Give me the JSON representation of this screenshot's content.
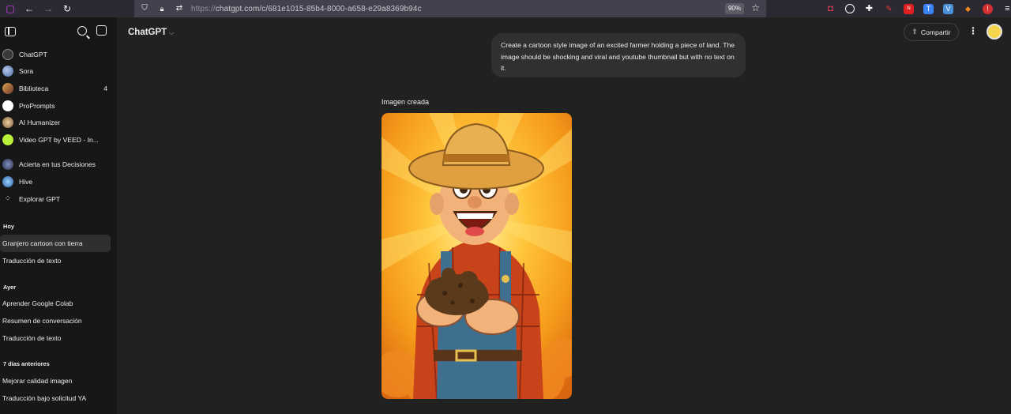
{
  "browser": {
    "url_scheme": "https://",
    "url_rest": "chatgpt.com/c/681e1015-85b4-8000-a658-e29a8369b94c",
    "zoom": "90%"
  },
  "sidebar": {
    "gpts": [
      {
        "label": "ChatGPT",
        "icon": "chatgpt-icon",
        "color": "#3a3a3a"
      },
      {
        "label": "Sora",
        "icon": "sora-icon",
        "color": "#6b8fc9"
      },
      {
        "label": "Biblioteca",
        "icon": "library-icon",
        "color": "#c8603a",
        "count": "4"
      },
      {
        "label": "ProPrompts",
        "icon": "proprompts-icon",
        "color": "#ffffff"
      },
      {
        "label": "AI Humanizer",
        "icon": "humanizer-icon",
        "color": "#c9a26b"
      },
      {
        "label": "Video GPT by VEED - In...",
        "icon": "veed-icon",
        "color": "#b8f03a"
      },
      {
        "label": "Acierta en tus Decisiones",
        "icon": "decisions-icon",
        "color": "#4a5a8a"
      },
      {
        "label": "Hive",
        "icon": "hive-icon",
        "color": "#3f7fbf"
      },
      {
        "label": "Explorar GPT",
        "icon": "explore-icon",
        "color": ""
      }
    ],
    "sections": [
      {
        "heading": "Hoy",
        "items": [
          "Granjero cartoon con tierra",
          "Traducción de texto"
        ]
      },
      {
        "heading": "Ayer",
        "items": [
          "Aprender Google Colab",
          "Resumen de conversación",
          "Traducción de texto"
        ]
      },
      {
        "heading": "7 días anteriores",
        "items": [
          "Mejorar calidad imagen",
          "Traducción bajo solicitud YA"
        ]
      }
    ]
  },
  "header": {
    "model": "ChatGPT",
    "share_label": "Compartir"
  },
  "chat": {
    "user_message": "Create a cartoon style image of an excited farmer holding a piece of land. The image should be shocking and viral and youtube thumbnail but with no text on it.",
    "image_label": "Imagen creada"
  },
  "colors": {
    "accent_bg": "#212121",
    "sidebar_bg": "#171717",
    "bubble_bg": "#303030"
  }
}
